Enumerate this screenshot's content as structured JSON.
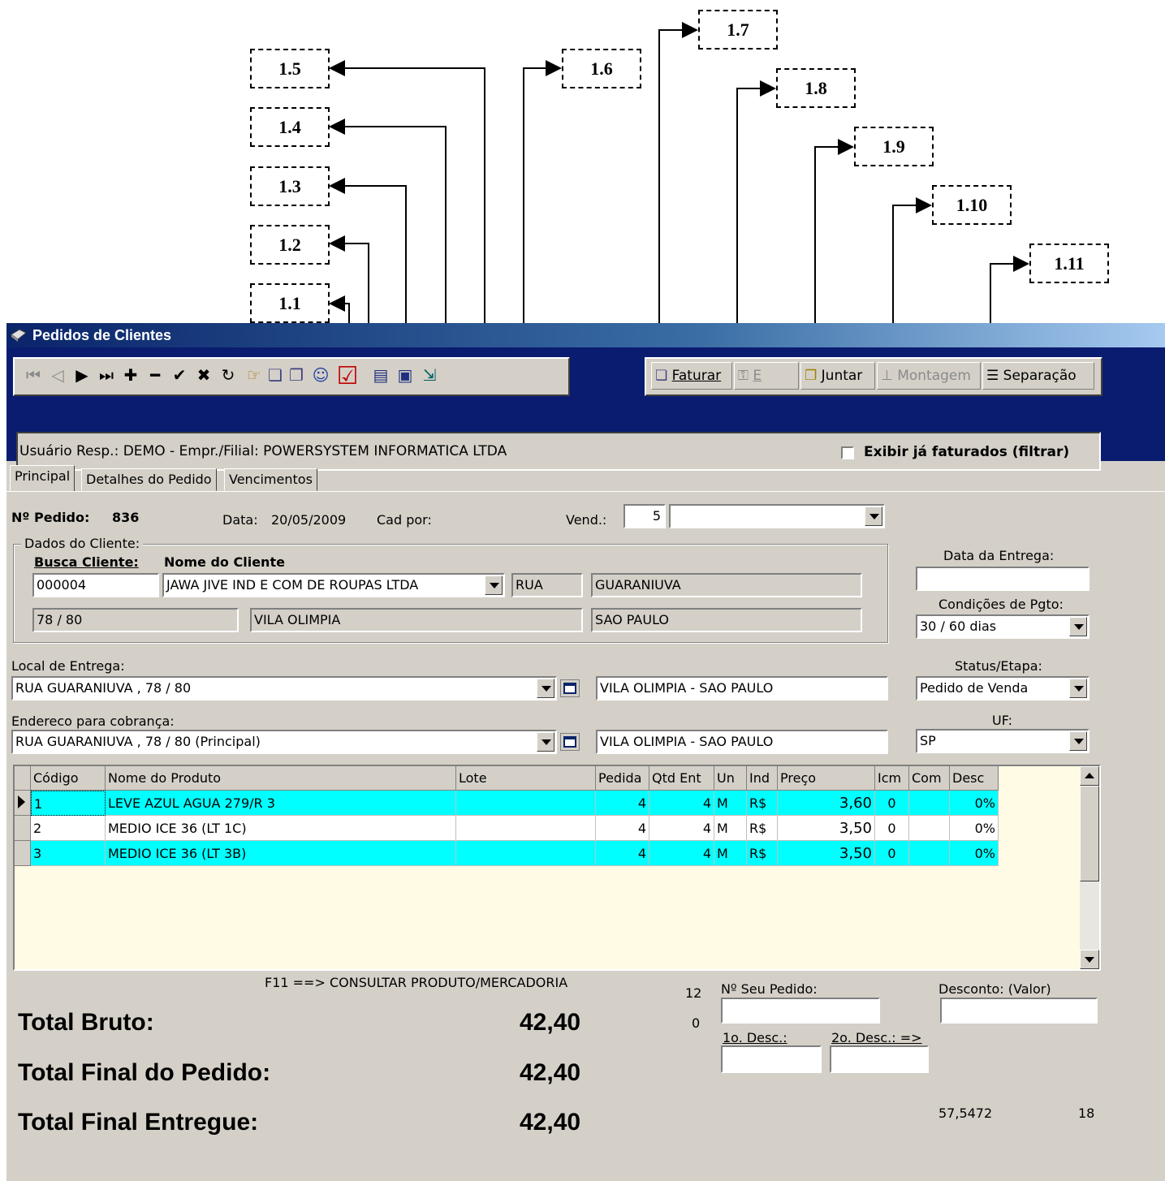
{
  "callouts": [
    "1.1",
    "1.2",
    "1.3",
    "1.4",
    "1.5",
    "1.6",
    "1.7",
    "1.8",
    "1.9",
    "1.10",
    "1.11"
  ],
  "window": {
    "title": "Pedidos de Clientes"
  },
  "toolbar": {
    "faturar": "Faturar",
    "e": "E",
    "juntar": "Juntar",
    "montagem": "Montagem",
    "separacao": "Separação"
  },
  "infobar": {
    "user_text": "Usuário Resp.: DEMO - Empr./Filial: POWERSYSTEM INFORMATICA LTDA",
    "show_billed": "Exibir já faturados (filtrar)"
  },
  "tabs": [
    "Principal",
    "Detalhes do Pedido",
    "Vencimentos"
  ],
  "order": {
    "number_label": "Nº Pedido:",
    "number": "836",
    "date_label": "Data:",
    "date": "20/05/2009",
    "cad_label": "Cad por:",
    "vend_label": "Vend.:",
    "vend_value": "5"
  },
  "client": {
    "group_label": "Dados do Cliente:",
    "search_label": "Busca Cliente:",
    "name_label": "Nome do Cliente",
    "code": "000004",
    "name": "JAWA JIVE IND E COM DE ROUPAS LTDA",
    "street_type": "RUA",
    "street": "GUARANIUVA",
    "number": "78 / 80",
    "district": "VILA OLIMPIA",
    "city": "SAO PAULO"
  },
  "right": {
    "delivery_date_label": "Data da Entrega:",
    "delivery_date": "",
    "payment_label": "Condições de Pgto:",
    "payment": "30 / 60 dias",
    "status_label": "Status/Etapa:",
    "status": "Pedido de Venda",
    "uf_label": "UF:",
    "uf": "SP"
  },
  "delivery": {
    "label": "Local de Entrega:",
    "address": "RUA GUARANIUVA , 78 / 80",
    "district_city": "VILA OLIMPIA - SAO PAULO"
  },
  "billing": {
    "label": "Endereco para cobrança:",
    "address": "RUA GUARANIUVA , 78 / 80 (Principal)",
    "district_city": "VILA OLIMPIA - SAO PAULO"
  },
  "grid": {
    "columns": [
      "Código",
      "Nome do Produto",
      "Lote",
      "Pedida",
      "Qtd Ent",
      "Un",
      "Ind",
      "Preço",
      "Icm",
      "Com",
      "Desc"
    ],
    "rows": [
      [
        "1",
        "LEVE AZUL AGUA 279/R 3",
        "",
        "4",
        "4",
        "M",
        "R$",
        "3,60",
        "0",
        "",
        "0%"
      ],
      [
        "2",
        "MEDIO ICE 36 (LT 1C)",
        "",
        "4",
        "4",
        "M",
        "R$",
        "3,50",
        "0",
        "",
        "0%"
      ],
      [
        "3",
        "MEDIO ICE 36 (LT 3B)",
        "",
        "4",
        "4",
        "M",
        "R$",
        "3,50",
        "0",
        "",
        "0%"
      ]
    ]
  },
  "bottom": {
    "hint": "F11 ==> CONSULTAR PRODUTO/MERCADORIA",
    "count_a": "12",
    "count_b": "0",
    "seu_pedido_label": "Nº Seu Pedido:",
    "desconto_label": "Desconto: (Valor)",
    "desc1_label": "1o. Desc.:",
    "desc2_label": "2o. Desc.: =>",
    "val_a": "57,5472",
    "val_b": "18"
  },
  "totals": {
    "bruto_label": "Total Bruto:",
    "bruto": "42,40",
    "final_label": "Total Final do Pedido:",
    "final": "42,40",
    "entregue_label": "Total Final Entregue:",
    "entregue": "42,40"
  },
  "colors": {
    "titlebar": "#0a246a",
    "band": "#0a1c6f",
    "face": "#d4d0c8",
    "row_highlight": "#00ffff",
    "grid_bg": "#fffbe5"
  }
}
